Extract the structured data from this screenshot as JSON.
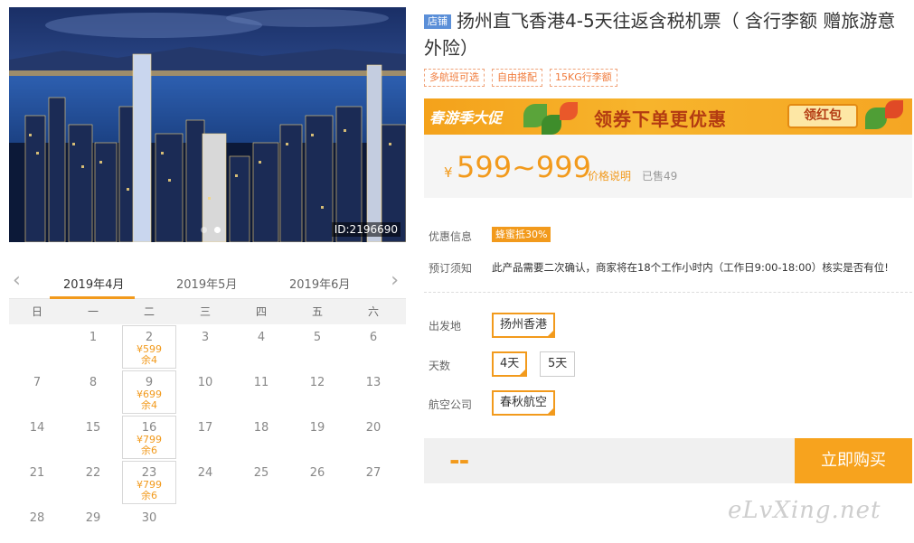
{
  "photo": {
    "id_label": "ID:2196690",
    "slides": 2,
    "active_slide": 1
  },
  "calendar": {
    "months": [
      "2019年4月",
      "2019年5月",
      "2019年6月"
    ],
    "active_month_index": 0,
    "weekdays": [
      "日",
      "一",
      "二",
      "三",
      "四",
      "五",
      "六"
    ],
    "leading_blanks": 1,
    "days": [
      {
        "day": "1"
      },
      {
        "day": "2",
        "price": "¥599",
        "stock": "余4"
      },
      {
        "day": "3"
      },
      {
        "day": "4"
      },
      {
        "day": "5"
      },
      {
        "day": "6"
      },
      {
        "day": "7"
      },
      {
        "day": "8"
      },
      {
        "day": "9",
        "price": "¥699",
        "stock": "余4"
      },
      {
        "day": "10"
      },
      {
        "day": "11"
      },
      {
        "day": "12"
      },
      {
        "day": "13"
      },
      {
        "day": "14"
      },
      {
        "day": "15"
      },
      {
        "day": "16",
        "price": "¥799",
        "stock": "余6"
      },
      {
        "day": "17"
      },
      {
        "day": "18"
      },
      {
        "day": "19"
      },
      {
        "day": "20"
      },
      {
        "day": "21"
      },
      {
        "day": "22"
      },
      {
        "day": "23",
        "price": "¥799",
        "stock": "余6"
      },
      {
        "day": "24"
      },
      {
        "day": "25"
      },
      {
        "day": "26"
      },
      {
        "day": "27"
      },
      {
        "day": "28"
      },
      {
        "day": "29"
      },
      {
        "day": "30"
      }
    ]
  },
  "product": {
    "badge": "店铺",
    "title": "扬州直飞香港4-5天往返含税机票（  含行李额 赠旅游意外险）",
    "tags": [
      "多航班可选",
      "自由搭配",
      "15KG行李额"
    ]
  },
  "promo": {
    "left_text": "春游季大促",
    "main_text": "领券下单更优惠",
    "button_label": "领红包"
  },
  "price": {
    "symbol": "¥",
    "range": "599~999",
    "explain_link": "价格说明",
    "sold": "已售49"
  },
  "info": {
    "discount_label": "优惠信息",
    "discount_badge": "蜂蜜抵30%",
    "notice_label": "预订须知",
    "notice_text": "此产品需要二次确认，商家将在18个工作小时内（工作日9:00-18:00）核实是否有位!"
  },
  "options": {
    "departure_label": "出发地",
    "departure_values": [
      "扬州香港"
    ],
    "days_label": "天数",
    "days_values": [
      "4天",
      "5天"
    ],
    "airline_label": "航空公司",
    "airline_values": [
      "春秋航空"
    ]
  },
  "buy": {
    "price_placeholder": "--",
    "button_label": "立即购买"
  },
  "watermark": "eLvXing.net",
  "colors": {
    "accent": "#f29a1c",
    "buy_button": "#f7a31e",
    "badge_blue": "#5b8fd8"
  }
}
